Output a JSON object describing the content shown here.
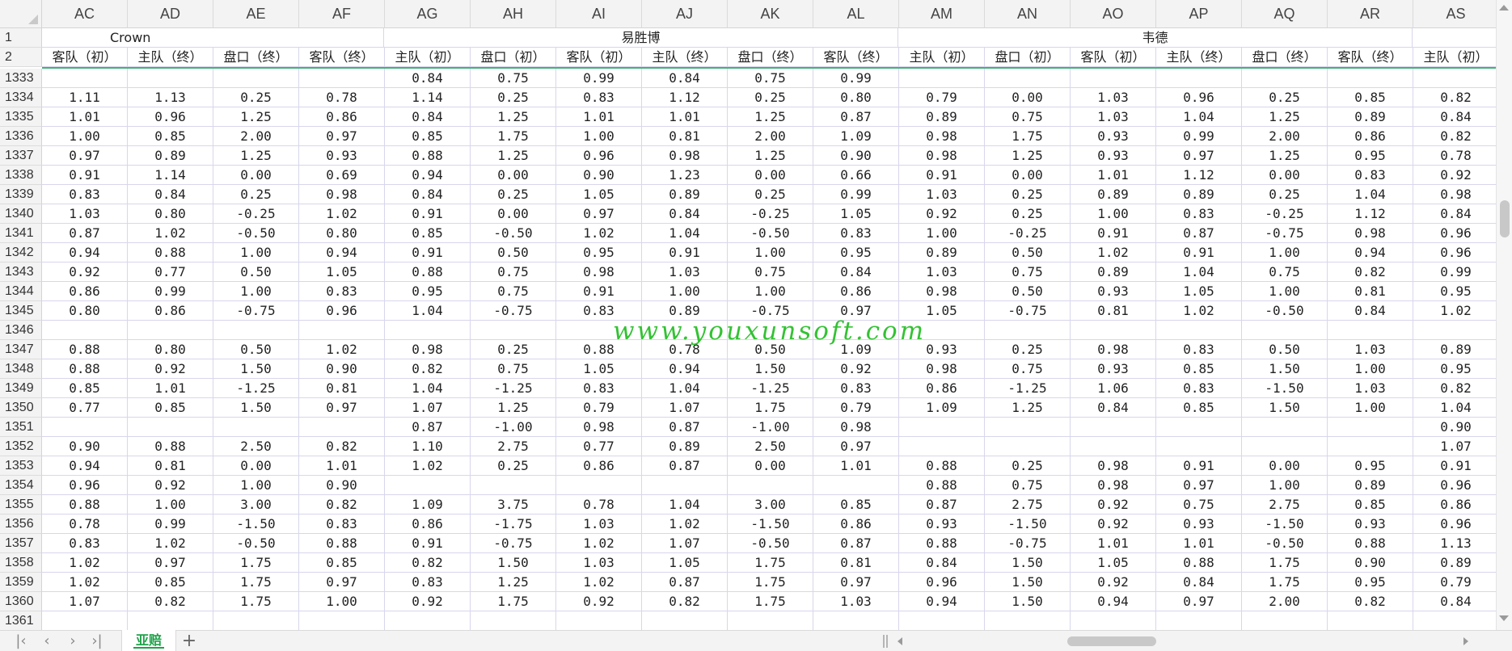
{
  "column_letters": [
    "AC",
    "AD",
    "AE",
    "AF",
    "AG",
    "AH",
    "AI",
    "AJ",
    "AK",
    "AL",
    "AM",
    "AN",
    "AO",
    "AP",
    "AQ",
    "AR",
    "AS"
  ],
  "header_row1": {
    "row_label": "1",
    "crown": "Crown",
    "ysb": "易胜博",
    "wd": "韦德"
  },
  "header_row2": {
    "row_label": "2",
    "cells": [
      "客队（初）",
      "主队（终）",
      "盘口（终）",
      "客队（终）",
      "主队（初）",
      "盘口（初）",
      "客队（初）",
      "主队（终）",
      "盘口（终）",
      "客队（终）",
      "主队（初）",
      "盘口（初）",
      "客队（初）",
      "主队（终）",
      "盘口（终）",
      "客队（终）",
      "主队（初）"
    ]
  },
  "rows": [
    {
      "n": "1333",
      "c": [
        "",
        "",
        "",
        "",
        "0.84",
        "0.75",
        "0.99",
        "0.84",
        "0.75",
        "0.99",
        "",
        "",
        "",
        "",
        "",
        "",
        ""
      ]
    },
    {
      "n": "1334",
      "c": [
        "1.11",
        "1.13",
        "0.25",
        "0.78",
        "1.14",
        "0.25",
        "0.83",
        "1.12",
        "0.25",
        "0.80",
        "0.79",
        "0.00",
        "1.03",
        "0.96",
        "0.25",
        "0.85",
        "0.82"
      ]
    },
    {
      "n": "1335",
      "c": [
        "1.01",
        "0.96",
        "1.25",
        "0.86",
        "0.84",
        "1.25",
        "1.01",
        "1.01",
        "1.25",
        "0.87",
        "0.89",
        "0.75",
        "1.03",
        "1.04",
        "1.25",
        "0.89",
        "0.84"
      ]
    },
    {
      "n": "1336",
      "c": [
        "1.00",
        "0.85",
        "2.00",
        "0.97",
        "0.85",
        "1.75",
        "1.00",
        "0.81",
        "2.00",
        "1.09",
        "0.98",
        "1.75",
        "0.93",
        "0.99",
        "2.00",
        "0.86",
        "0.82"
      ]
    },
    {
      "n": "1337",
      "c": [
        "0.97",
        "0.89",
        "1.25",
        "0.93",
        "0.88",
        "1.25",
        "0.96",
        "0.98",
        "1.25",
        "0.90",
        "0.98",
        "1.25",
        "0.93",
        "0.97",
        "1.25",
        "0.95",
        "0.78"
      ]
    },
    {
      "n": "1338",
      "c": [
        "0.91",
        "1.14",
        "0.00",
        "0.69",
        "0.94",
        "0.00",
        "0.90",
        "1.23",
        "0.00",
        "0.66",
        "0.91",
        "0.00",
        "1.01",
        "1.12",
        "0.00",
        "0.83",
        "0.92"
      ]
    },
    {
      "n": "1339",
      "c": [
        "0.83",
        "0.84",
        "0.25",
        "0.98",
        "0.84",
        "0.25",
        "1.05",
        "0.89",
        "0.25",
        "0.99",
        "1.03",
        "0.25",
        "0.89",
        "0.89",
        "0.25",
        "1.04",
        "0.98"
      ]
    },
    {
      "n": "1340",
      "c": [
        "1.03",
        "0.80",
        "-0.25",
        "1.02",
        "0.91",
        "0.00",
        "0.97",
        "0.84",
        "-0.25",
        "1.05",
        "0.92",
        "0.25",
        "1.00",
        "0.83",
        "-0.25",
        "1.12",
        "0.84"
      ]
    },
    {
      "n": "1341",
      "c": [
        "0.87",
        "1.02",
        "-0.50",
        "0.80",
        "0.85",
        "-0.50",
        "1.02",
        "1.04",
        "-0.50",
        "0.83",
        "1.00",
        "-0.25",
        "0.91",
        "0.87",
        "-0.75",
        "0.98",
        "0.96"
      ]
    },
    {
      "n": "1342",
      "c": [
        "0.94",
        "0.88",
        "1.00",
        "0.94",
        "0.91",
        "0.50",
        "0.95",
        "0.91",
        "1.00",
        "0.95",
        "0.89",
        "0.50",
        "1.02",
        "0.91",
        "1.00",
        "0.94",
        "0.96"
      ]
    },
    {
      "n": "1343",
      "c": [
        "0.92",
        "0.77",
        "0.50",
        "1.05",
        "0.88",
        "0.75",
        "0.98",
        "1.03",
        "0.75",
        "0.84",
        "1.03",
        "0.75",
        "0.89",
        "1.04",
        "0.75",
        "0.82",
        "0.99"
      ]
    },
    {
      "n": "1344",
      "c": [
        "0.86",
        "0.99",
        "1.00",
        "0.83",
        "0.95",
        "0.75",
        "0.91",
        "1.00",
        "1.00",
        "0.86",
        "0.98",
        "0.50",
        "0.93",
        "1.05",
        "1.00",
        "0.81",
        "0.95"
      ]
    },
    {
      "n": "1345",
      "c": [
        "0.80",
        "0.86",
        "-0.75",
        "0.96",
        "1.04",
        "-0.75",
        "0.83",
        "0.89",
        "-0.75",
        "0.97",
        "1.05",
        "-0.75",
        "0.81",
        "1.02",
        "-0.50",
        "0.84",
        "1.02"
      ]
    },
    {
      "n": "1346",
      "c": [
        "",
        "",
        "",
        "",
        "",
        "",
        "",
        "",
        "",
        "",
        "",
        "",
        "",
        "",
        "",
        "",
        ""
      ]
    },
    {
      "n": "1347",
      "c": [
        "0.88",
        "0.80",
        "0.50",
        "1.02",
        "0.98",
        "0.25",
        "0.88",
        "0.78",
        "0.50",
        "1.09",
        "0.93",
        "0.25",
        "0.98",
        "0.83",
        "0.50",
        "1.03",
        "0.89"
      ]
    },
    {
      "n": "1348",
      "c": [
        "0.88",
        "0.92",
        "1.50",
        "0.90",
        "0.82",
        "0.75",
        "1.05",
        "0.94",
        "1.50",
        "0.92",
        "0.98",
        "0.75",
        "0.93",
        "0.85",
        "1.50",
        "1.00",
        "0.95"
      ]
    },
    {
      "n": "1349",
      "c": [
        "0.85",
        "1.01",
        "-1.25",
        "0.81",
        "1.04",
        "-1.25",
        "0.83",
        "1.04",
        "-1.25",
        "0.83",
        "0.86",
        "-1.25",
        "1.06",
        "0.83",
        "-1.50",
        "1.03",
        "0.82"
      ]
    },
    {
      "n": "1350",
      "c": [
        "0.77",
        "0.85",
        "1.50",
        "0.97",
        "1.07",
        "1.25",
        "0.79",
        "1.07",
        "1.75",
        "0.79",
        "1.09",
        "1.25",
        "0.84",
        "0.85",
        "1.50",
        "1.00",
        "1.04"
      ]
    },
    {
      "n": "1351",
      "c": [
        "",
        "",
        "",
        "",
        "0.87",
        "-1.00",
        "0.98",
        "0.87",
        "-1.00",
        "0.98",
        "",
        "",
        "",
        "",
        "",
        "",
        "0.90"
      ]
    },
    {
      "n": "1352",
      "c": [
        "0.90",
        "0.88",
        "2.50",
        "0.82",
        "1.10",
        "2.75",
        "0.77",
        "0.89",
        "2.50",
        "0.97",
        "",
        "",
        "",
        "",
        "",
        "",
        "1.07"
      ]
    },
    {
      "n": "1353",
      "c": [
        "0.94",
        "0.81",
        "0.00",
        "1.01",
        "1.02",
        "0.25",
        "0.86",
        "0.87",
        "0.00",
        "1.01",
        "0.88",
        "0.25",
        "0.98",
        "0.91",
        "0.00",
        "0.95",
        "0.91"
      ]
    },
    {
      "n": "1354",
      "c": [
        "0.96",
        "0.92",
        "1.00",
        "0.90",
        "",
        "",
        "",
        "",
        "",
        "",
        "0.88",
        "0.75",
        "0.98",
        "0.97",
        "1.00",
        "0.89",
        "0.96"
      ]
    },
    {
      "n": "1355",
      "c": [
        "0.88",
        "1.00",
        "3.00",
        "0.82",
        "1.09",
        "3.75",
        "0.78",
        "1.04",
        "3.00",
        "0.85",
        "0.87",
        "2.75",
        "0.92",
        "0.75",
        "2.75",
        "0.85",
        "0.86"
      ]
    },
    {
      "n": "1356",
      "c": [
        "0.78",
        "0.99",
        "-1.50",
        "0.83",
        "0.86",
        "-1.75",
        "1.03",
        "1.02",
        "-1.50",
        "0.86",
        "0.93",
        "-1.50",
        "0.92",
        "0.93",
        "-1.50",
        "0.93",
        "0.96"
      ]
    },
    {
      "n": "1357",
      "c": [
        "0.83",
        "1.02",
        "-0.50",
        "0.88",
        "0.91",
        "-0.75",
        "1.02",
        "1.07",
        "-0.50",
        "0.87",
        "0.88",
        "-0.75",
        "1.01",
        "1.01",
        "-0.50",
        "0.88",
        "1.13"
      ]
    },
    {
      "n": "1358",
      "c": [
        "1.02",
        "0.97",
        "1.75",
        "0.85",
        "0.82",
        "1.50",
        "1.03",
        "1.05",
        "1.75",
        "0.81",
        "0.84",
        "1.50",
        "1.05",
        "0.88",
        "1.75",
        "0.90",
        "0.89"
      ]
    },
    {
      "n": "1359",
      "c": [
        "1.02",
        "0.85",
        "1.75",
        "0.97",
        "0.83",
        "1.25",
        "1.02",
        "0.87",
        "1.75",
        "0.97",
        "0.96",
        "1.50",
        "0.92",
        "0.84",
        "1.75",
        "0.95",
        "0.79"
      ]
    },
    {
      "n": "1360",
      "c": [
        "1.07",
        "0.82",
        "1.75",
        "1.00",
        "0.92",
        "1.75",
        "0.92",
        "0.82",
        "1.75",
        "1.03",
        "0.94",
        "1.50",
        "0.94",
        "0.97",
        "2.00",
        "0.82",
        "0.84"
      ]
    },
    {
      "n": "1361",
      "c": [
        "",
        "",
        "",
        "",
        "",
        "",
        "",
        "",
        "",
        "",
        "",
        "",
        "",
        "",
        "",
        "",
        ""
      ]
    }
  ],
  "watermark": "www.youxunsoft.com",
  "sheet_tab": "亚赔",
  "add_sheet": "+",
  "nav_icons": [
    "first-sheet-icon",
    "prev-sheet-icon",
    "next-sheet-icon",
    "last-sheet-icon"
  ],
  "colors": {
    "accent_green": "#1fa34a",
    "freeze_line": "#3fb27a",
    "watermark": "#33c233"
  }
}
